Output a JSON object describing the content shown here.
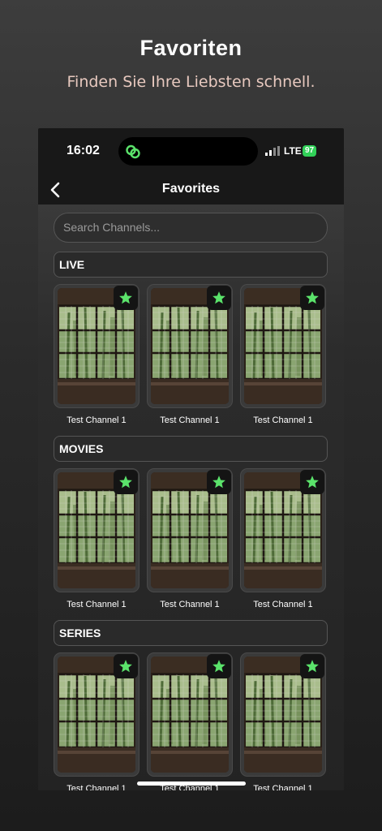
{
  "promo": {
    "title": "Favoriten",
    "subtitle": "Finden Sie Ihre Liebsten schnell."
  },
  "status_bar": {
    "time": "16:02",
    "network": "LTE",
    "battery": "97"
  },
  "nav": {
    "title": "Favorites"
  },
  "search": {
    "placeholder": "Search Channels..."
  },
  "sections": [
    {
      "label": "LIVE",
      "items": [
        {
          "title": "Test Channel 1",
          "favorite": true
        },
        {
          "title": "Test Channel 1",
          "favorite": true
        },
        {
          "title": "Test Channel 1",
          "favorite": true
        }
      ]
    },
    {
      "label": "MOVIES",
      "items": [
        {
          "title": "Test Channel 1",
          "favorite": true
        },
        {
          "title": "Test Channel 1",
          "favorite": true
        },
        {
          "title": "Test Channel 1",
          "favorite": true
        }
      ]
    },
    {
      "label": "SERIES",
      "items": [
        {
          "title": "Test Channel 1",
          "favorite": true
        },
        {
          "title": "Test Channel 1",
          "favorite": true
        },
        {
          "title": "Test Channel 1",
          "favorite": true
        }
      ]
    }
  ],
  "colors": {
    "star": "#5be36b",
    "battery": "#31d158",
    "subtitle": "#e8c9bf"
  },
  "icons": {
    "back": "chevron-left-icon",
    "favorite": "star-icon",
    "island_app": "link-icon",
    "signal": "signal-icon"
  }
}
